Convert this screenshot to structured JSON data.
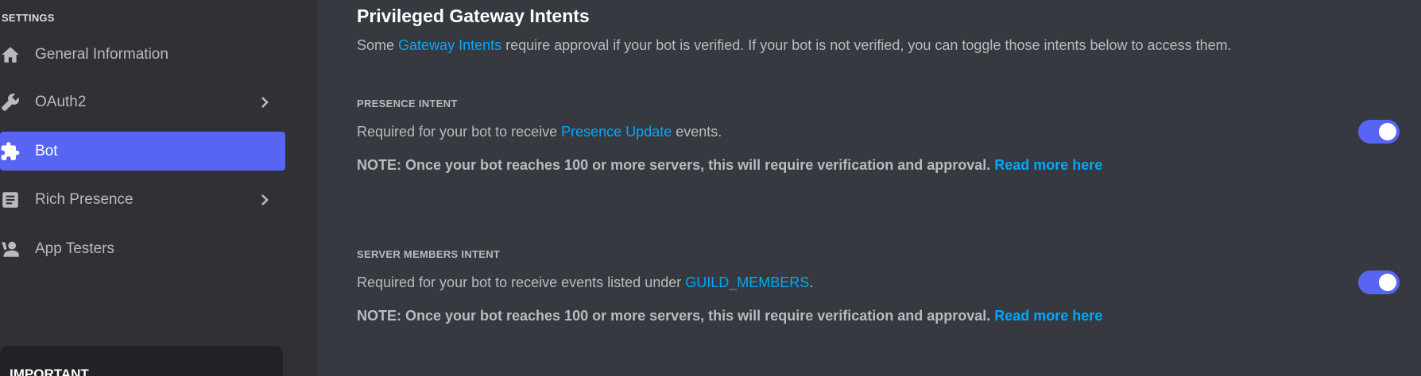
{
  "sidebar": {
    "heading": "SETTINGS",
    "items": [
      {
        "label": "General Information",
        "icon": "home-icon"
      },
      {
        "label": "OAuth2",
        "icon": "wrench-icon",
        "chevron": true
      },
      {
        "label": "Bot",
        "icon": "puzzle-icon",
        "active": true
      },
      {
        "label": "Rich Presence",
        "icon": "document-icon",
        "chevron": true
      },
      {
        "label": "App Testers",
        "icon": "user-icon"
      }
    ],
    "important_label": "IMPORTANT"
  },
  "main": {
    "title": "Privileged Gateway Intents",
    "desc_before": "Some ",
    "desc_link": "Gateway Intents",
    "desc_after": " require approval if your bot is verified. If your bot is not verified, you can toggle those intents below to access them.",
    "intents": [
      {
        "heading": "PRESENCE INTENT",
        "desc_before": "Required for your bot to receive ",
        "desc_link": "Presence Update",
        "desc_after": " events.",
        "note": "NOTE: Once your bot reaches 100 or more servers, this will require verification and approval. ",
        "note_link": "Read more here",
        "enabled": true
      },
      {
        "heading": "SERVER MEMBERS INTENT",
        "desc_before": "Required for your bot to receive events listed under ",
        "desc_link": "GUILD_MEMBERS",
        "desc_after": ".",
        "note": "NOTE: Once your bot reaches 100 or more servers, this will require verification and approval. ",
        "note_link": "Read more here",
        "enabled": true
      }
    ]
  },
  "colors": {
    "sidebar_bg": "#2f3136",
    "main_bg": "#36393f",
    "accent": "#5865f2",
    "link": "#00a8fc"
  }
}
